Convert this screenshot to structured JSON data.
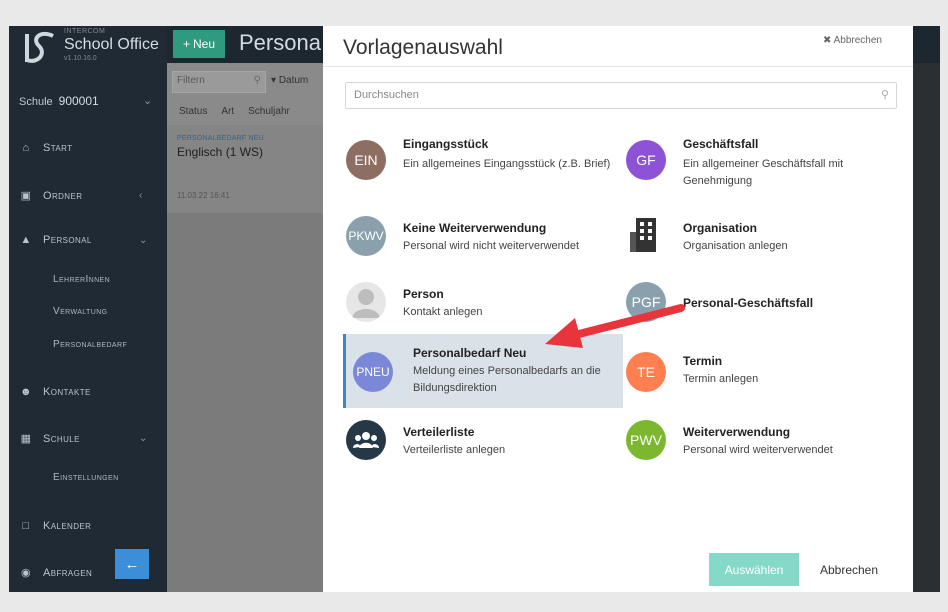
{
  "app": {
    "brand": "INTERCOM",
    "name": "School Office",
    "version": "v1.10.16.0",
    "school_label": "Schule",
    "school_value": "900001"
  },
  "sidebar": {
    "items": [
      {
        "label": "Start",
        "icon": "home-icon"
      },
      {
        "label": "Ordner",
        "icon": "folder-icon"
      },
      {
        "label": "Personal",
        "icon": "graduation-cap-icon"
      },
      {
        "label": "Kontakte",
        "icon": "users-icon"
      },
      {
        "label": "Schule",
        "icon": "building-icon"
      },
      {
        "label": "Kalender",
        "icon": "calendar-icon"
      },
      {
        "label": "Abfragen",
        "icon": "binoculars-icon"
      }
    ],
    "personal_sub": [
      "LehrerInnen",
      "Verwaltung",
      "Personalbedarf"
    ],
    "schule_sub": [
      "Einstellungen"
    ]
  },
  "header": {
    "new_label": "Neu",
    "page_title": "Persona"
  },
  "list": {
    "filter_placeholder": "Filtern",
    "sort_label": "Datum",
    "columns": [
      "Status",
      "Art",
      "Schuljahr"
    ],
    "item": {
      "tag": "PERSONALBEDARF NEU",
      "title": "Englisch (1 WS)",
      "date": "11.03.22 16:41"
    }
  },
  "modal": {
    "title": "Vorlagenauswahl",
    "close_label": "Abbrechen",
    "search_placeholder": "Durchsuchen",
    "options": [
      {
        "abbr": "EIN",
        "title": "Eingangsstück",
        "desc": "Ein allgemeines Eingangsstück (z.B. Brief)",
        "color": "#8d6e63"
      },
      {
        "abbr": "GF",
        "title": "Geschäftsfall",
        "desc": "Ein allgemeiner Geschäftsfall mit Genehmigung",
        "color": "#8e52d6"
      },
      {
        "abbr": "PKWV",
        "title": "Keine Weiterverwendung",
        "desc": "Personal wird nicht weiterverwendet",
        "color": "#8aa1ad"
      },
      {
        "abbr": "",
        "title": "Organisation",
        "desc": "Organisation anlegen",
        "color": "#333333"
      },
      {
        "abbr": "",
        "title": "Person",
        "desc": "Kontakt anlegen",
        "color": "#bdbdbd"
      },
      {
        "abbr": "PGF",
        "title": "Personal-Geschäftsfall",
        "desc": "",
        "color": "#8aa1ad"
      },
      {
        "abbr": "PNEU",
        "title": "Personalbedarf Neu",
        "desc": "Meldung eines Personalbedarfs an die Bildungsdirektion",
        "color": "#7b88d8"
      },
      {
        "abbr": "TE",
        "title": "Termin",
        "desc": "Termin anlegen",
        "color": "#ff7f50"
      },
      {
        "abbr": "",
        "title": "Verteilerliste",
        "desc": "Verteilerliste anlegen",
        "color": "#263845"
      },
      {
        "abbr": "PWV",
        "title": "Weiterverwendung",
        "desc": "Personal wird weiterverwendet",
        "color": "#7cb82f"
      }
    ],
    "select_label": "Auswählen",
    "cancel_label": "Abbrechen"
  },
  "colors": {
    "accent": "#3e85c8",
    "new_button": "#2f9a7e",
    "select_button": "#84d9c8",
    "arrow": "#e8343b"
  }
}
